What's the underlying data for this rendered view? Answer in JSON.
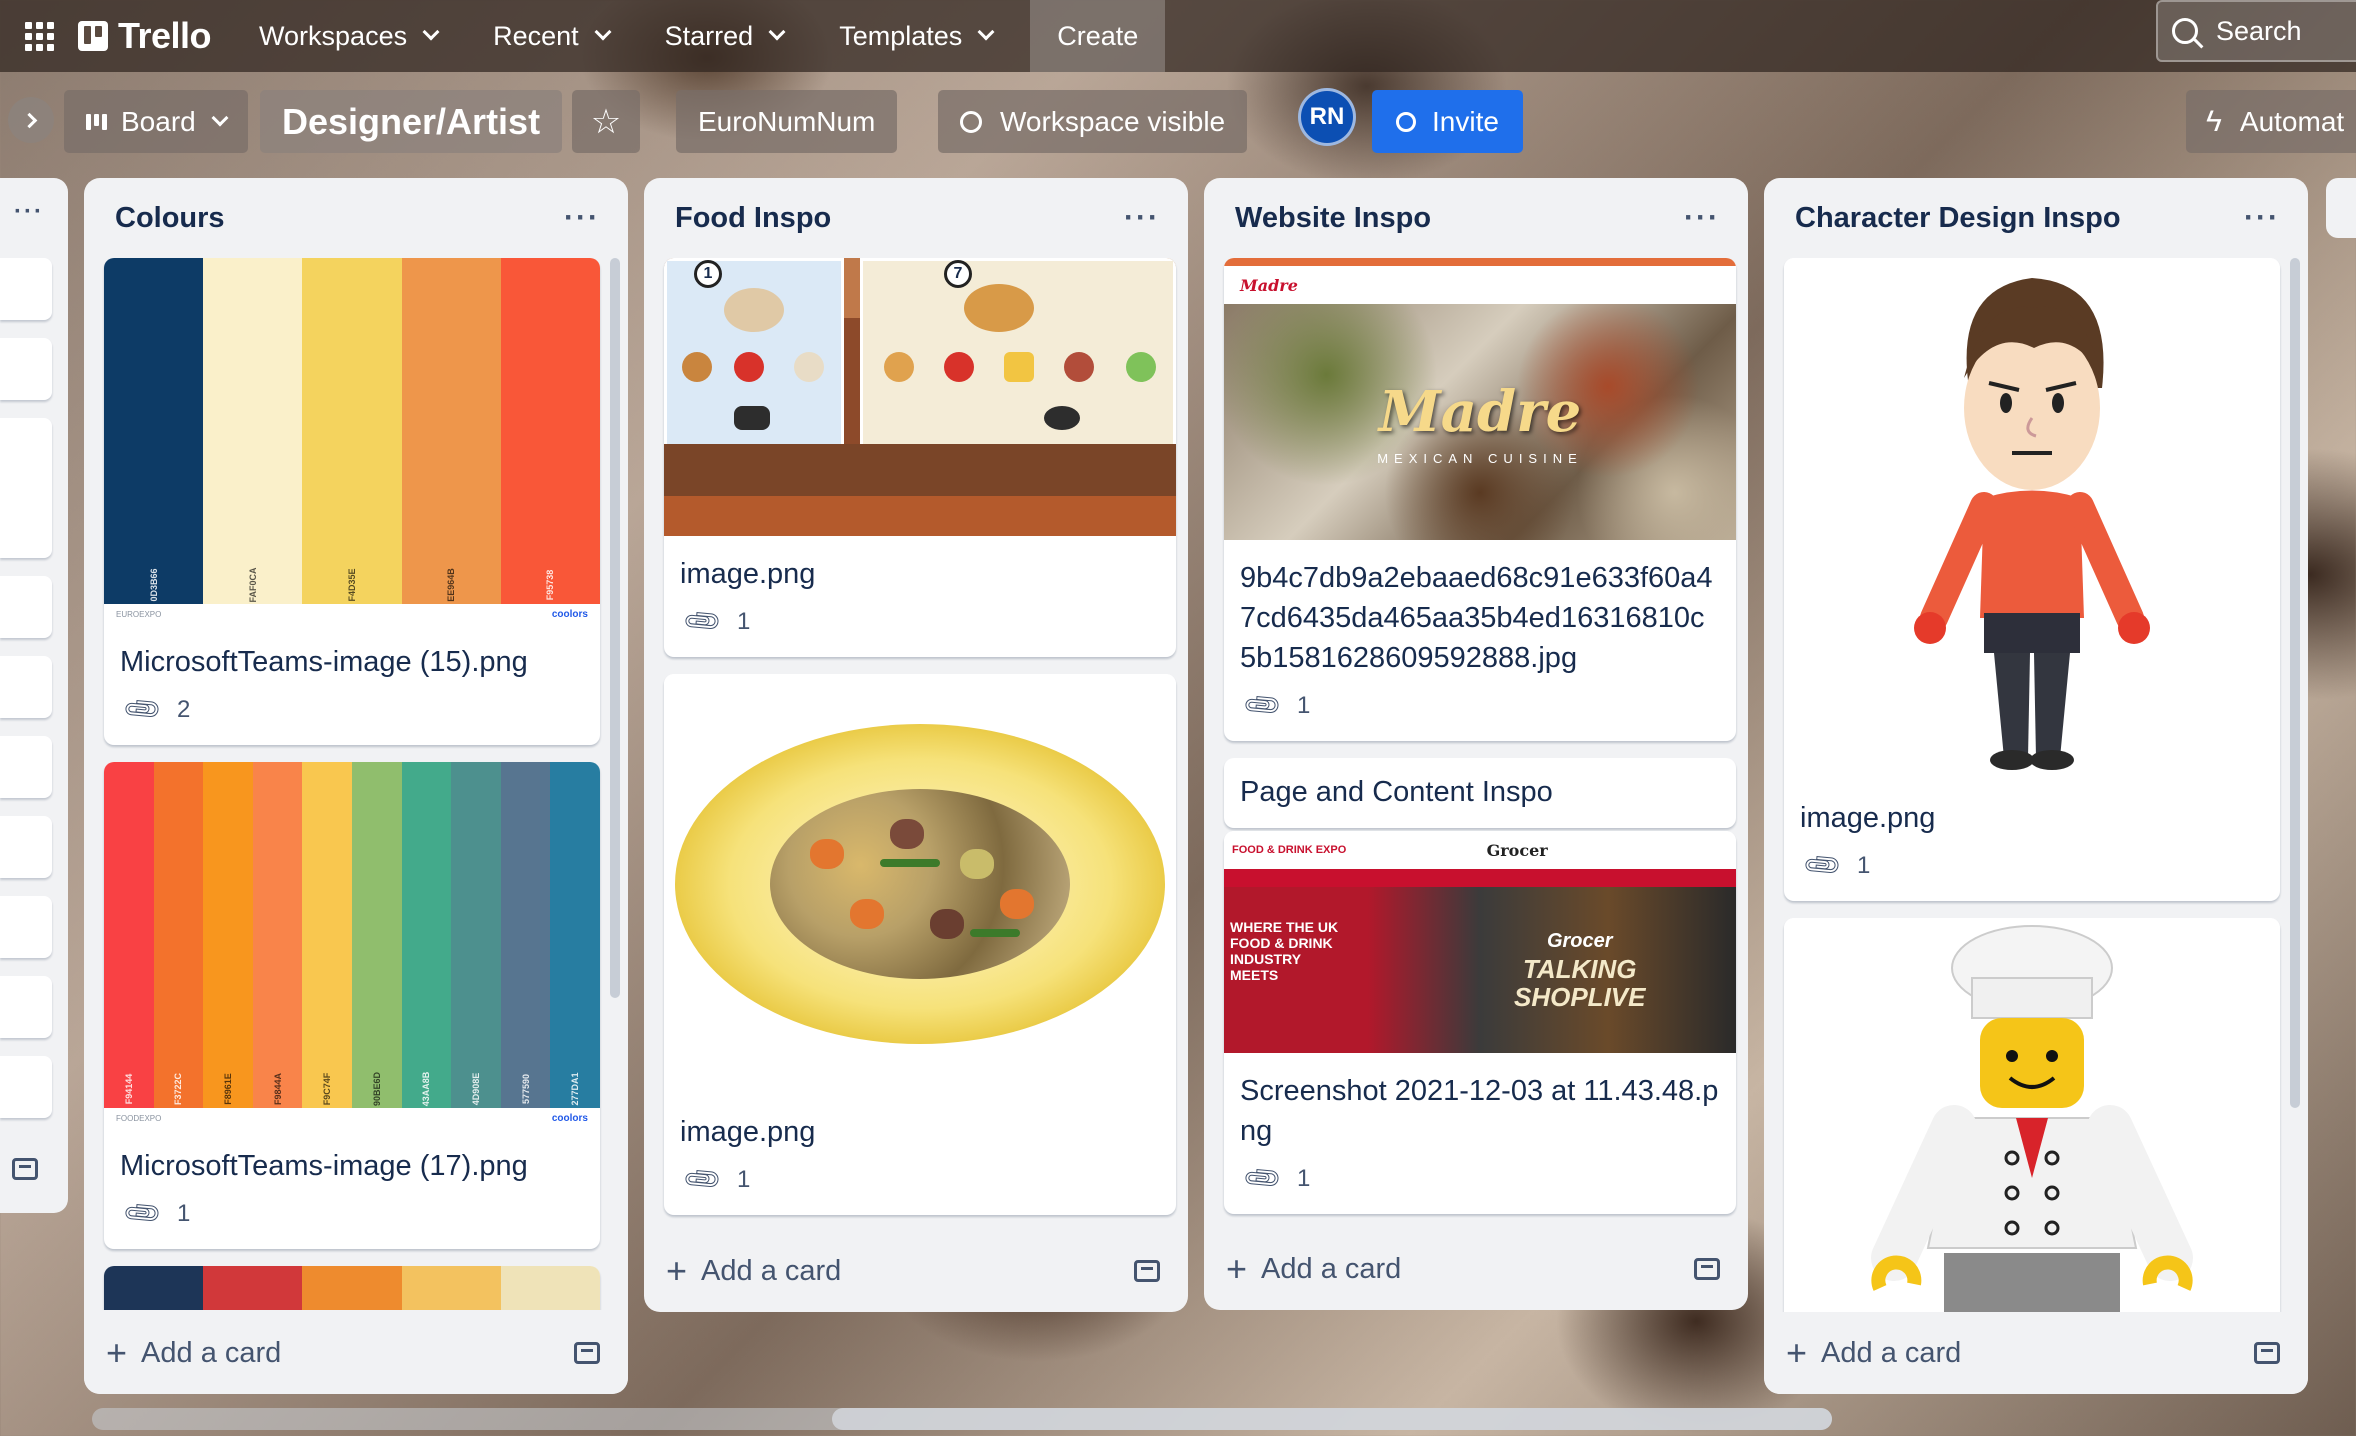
{
  "topnav": {
    "logo": "Trello",
    "items": [
      "Workspaces",
      "Recent",
      "Starred",
      "Templates"
    ],
    "create": "Create",
    "search": "Search"
  },
  "board": {
    "view": "Board",
    "title": "Designer/Artist",
    "workspace": "EuroNumNum",
    "visibility": "Workspace visible",
    "avatar": "RN",
    "invite": "Invite",
    "automation": "Automat"
  },
  "lists": [
    {
      "title": "Colours",
      "cards": [
        {
          "title": "MicrosoftTeams-image (15).png",
          "attachments": "2",
          "palette": {
            "colors": [
              "#0D3B66",
              "#FAF0CA",
              "#F4D35E",
              "#EE964B",
              "#F95738"
            ],
            "codes": [
              "0D3B66",
              "FAF0CA",
              "F4D35E",
              "EE964B",
              "F95738"
            ],
            "left_caption": "EUROEXPO",
            "brand": "coolors"
          }
        },
        {
          "title": "MicrosoftTeams-image (17).png",
          "attachments": "1",
          "palette": {
            "colors": [
              "#F94144",
              "#F3722C",
              "#F8961E",
              "#F9844A",
              "#F9C74F",
              "#90BE6D",
              "#43AA8B",
              "#4D908E",
              "#577590",
              "#277DA1"
            ],
            "codes": [
              "F94144",
              "F3722C",
              "F8961E",
              "F9844A",
              "F9C74F",
              "90BE6D",
              "43AA8B",
              "4D908E",
              "577590",
              "277DA1"
            ],
            "left_caption": "FOODEXPO",
            "brand": "coolors"
          }
        },
        {
          "palette": {
            "colors": [
              "#1D3557",
              "#D1383A",
              "#EE8B2E",
              "#F3C25F",
              "#EFE3B8"
            ]
          }
        }
      ],
      "add_card": "Add a card"
    },
    {
      "title": "Food Inspo",
      "cards": [
        {
          "title": "image.png",
          "attachments": "1",
          "cover_badges": [
            "1",
            "7"
          ]
        },
        {
          "title": "image.png",
          "attachments": "1"
        }
      ],
      "add_card": "Add a card"
    },
    {
      "title": "Website Inspo",
      "cards": [
        {
          "title": "9b4c7db9a2ebaaed68c91e633f60a47cd6435da465aa35b4ed16316810c5b1581628609592888.jpg",
          "attachments": "1",
          "cover": {
            "brand": "Madre",
            "subtitle": "MEXICAN CUISINE"
          }
        },
        {
          "title": "Page and Content Inspo"
        },
        {
          "title": "Screenshot 2021-12-03 at 11.43.48.png",
          "attachments": "1",
          "cover": {
            "header_left": "FOOD & DRINK EXPO",
            "header_brand": "Grocer",
            "headline": "WHERE THE UK FOOD & DRINK INDUSTRY MEETS",
            "event_line1": "Grocer",
            "event_line2": "TALKING",
            "event_line3": "SHOPLIVE"
          }
        }
      ],
      "add_card": "Add a card"
    },
    {
      "title": "Character Design Inspo",
      "cards": [
        {
          "title": "image.png",
          "attachments": "1"
        },
        {
          "title": ""
        }
      ],
      "add_card": "Add a card"
    }
  ],
  "colors": {
    "invite": "#1f6feb",
    "avatar": "#0c4fb3",
    "list_bg": "#f1f2f4"
  }
}
